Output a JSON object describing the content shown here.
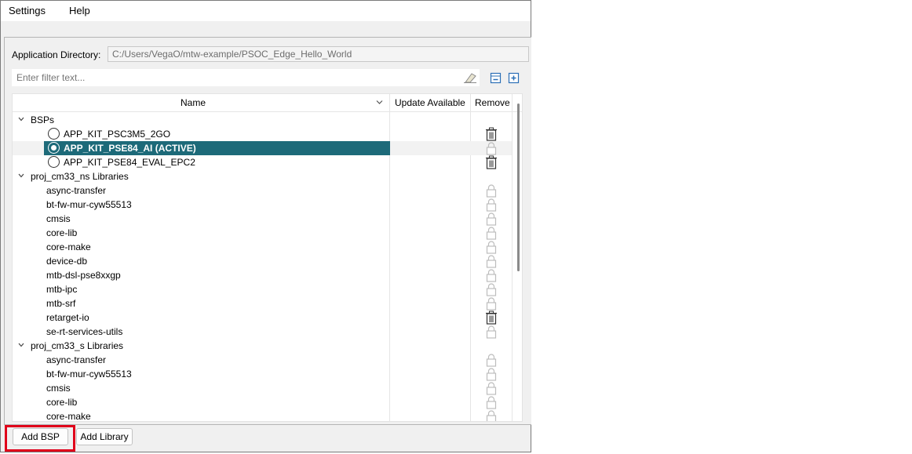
{
  "menu": {
    "settings": "Settings",
    "help": "Help"
  },
  "app_dir": {
    "label": "Application Directory:",
    "value": "C:/Users/VegaO/mtw-example/PSOC_Edge_Hello_World"
  },
  "filter": {
    "placeholder": "Enter filter text..."
  },
  "columns": {
    "name": "Name",
    "update": "Update Available",
    "remove": "Remove"
  },
  "rows": [
    {
      "kind": "group",
      "label": "BSPs",
      "remove_icon": "none"
    },
    {
      "kind": "bsp",
      "label": "APP_KIT_PSC3M5_2GO",
      "selected": false,
      "remove_icon": "trash-icon"
    },
    {
      "kind": "bsp",
      "label": "APP_KIT_PSE84_AI (ACTIVE)",
      "selected": true,
      "remove_icon": "lock-icon"
    },
    {
      "kind": "bsp",
      "label": "APP_KIT_PSE84_EVAL_EPC2",
      "selected": false,
      "remove_icon": "trash-icon"
    },
    {
      "kind": "group",
      "label": "proj_cm33_ns Libraries",
      "remove_icon": "none"
    },
    {
      "kind": "lib",
      "label": "async-transfer",
      "remove_icon": "lock-icon"
    },
    {
      "kind": "lib",
      "label": "bt-fw-mur-cyw55513",
      "remove_icon": "lock-icon"
    },
    {
      "kind": "lib",
      "label": "cmsis",
      "remove_icon": "lock-icon"
    },
    {
      "kind": "lib",
      "label": "core-lib",
      "remove_icon": "lock-icon"
    },
    {
      "kind": "lib",
      "label": "core-make",
      "remove_icon": "lock-icon"
    },
    {
      "kind": "lib",
      "label": "device-db",
      "remove_icon": "lock-icon"
    },
    {
      "kind": "lib",
      "label": "mtb-dsl-pse8xxgp",
      "remove_icon": "lock-icon"
    },
    {
      "kind": "lib",
      "label": "mtb-ipc",
      "remove_icon": "lock-icon"
    },
    {
      "kind": "lib",
      "label": "mtb-srf",
      "remove_icon": "lock-icon"
    },
    {
      "kind": "lib",
      "label": "retarget-io",
      "remove_icon": "trash-icon"
    },
    {
      "kind": "lib",
      "label": "se-rt-services-utils",
      "remove_icon": "lock-icon"
    },
    {
      "kind": "group",
      "label": "proj_cm33_s Libraries",
      "remove_icon": "none"
    },
    {
      "kind": "lib",
      "label": "async-transfer",
      "remove_icon": "lock-icon"
    },
    {
      "kind": "lib",
      "label": "bt-fw-mur-cyw55513",
      "remove_icon": "lock-icon"
    },
    {
      "kind": "lib",
      "label": "cmsis",
      "remove_icon": "lock-icon"
    },
    {
      "kind": "lib",
      "label": "core-lib",
      "remove_icon": "lock-icon"
    },
    {
      "kind": "lib",
      "label": "core-make",
      "remove_icon": "lock-icon"
    }
  ],
  "buttons": {
    "add_bsp": "Add BSP",
    "add_library": "Add Library"
  },
  "colors": {
    "selection": "#1d6a79",
    "highlight_box": "#e0001a"
  }
}
